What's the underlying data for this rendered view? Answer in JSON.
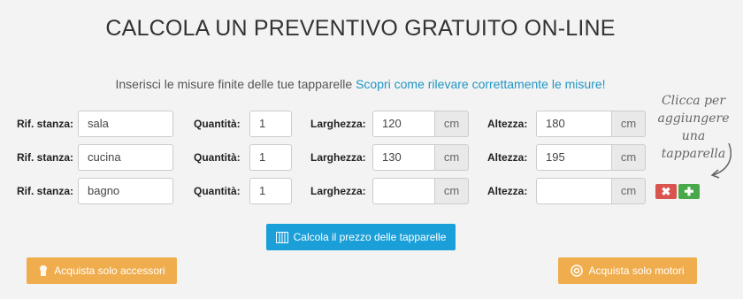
{
  "header": {
    "title": "CALCOLA UN PREVENTIVO GRATUITO ON-LINE",
    "subtitle_text": "Inserisci le misure finite delle tue tapparelle",
    "subtitle_link": "Scopri come rilevare correttamente le misure!"
  },
  "labels": {
    "room": "Rif. stanza:",
    "quantity": "Quantità:",
    "width": "Larghezza:",
    "height": "Altezza:",
    "unit": "cm"
  },
  "rows": [
    {
      "room": "sala",
      "quantity": "1",
      "width": "120",
      "height": "180"
    },
    {
      "room": "cucina",
      "quantity": "1",
      "width": "130",
      "height": "195"
    },
    {
      "room": "bagno",
      "quantity": "1",
      "width": "",
      "height": ""
    }
  ],
  "row_actions": {
    "delete_symbol": "✖",
    "add_symbol": "✚",
    "delete_color": "#d9534f",
    "add_color": "#49a94a"
  },
  "hint": {
    "line1": "Clicca per",
    "line2": "aggiungere",
    "line3": "una tapparella"
  },
  "buttons": {
    "calculate": "Calcola il prezzo delle tapparelle",
    "accessories": "Acquista solo accessori",
    "motors": "Acquista solo motori"
  },
  "colors": {
    "primary": "#1a9fd8",
    "orange": "#f0ad4e",
    "link": "#1f96c4"
  }
}
